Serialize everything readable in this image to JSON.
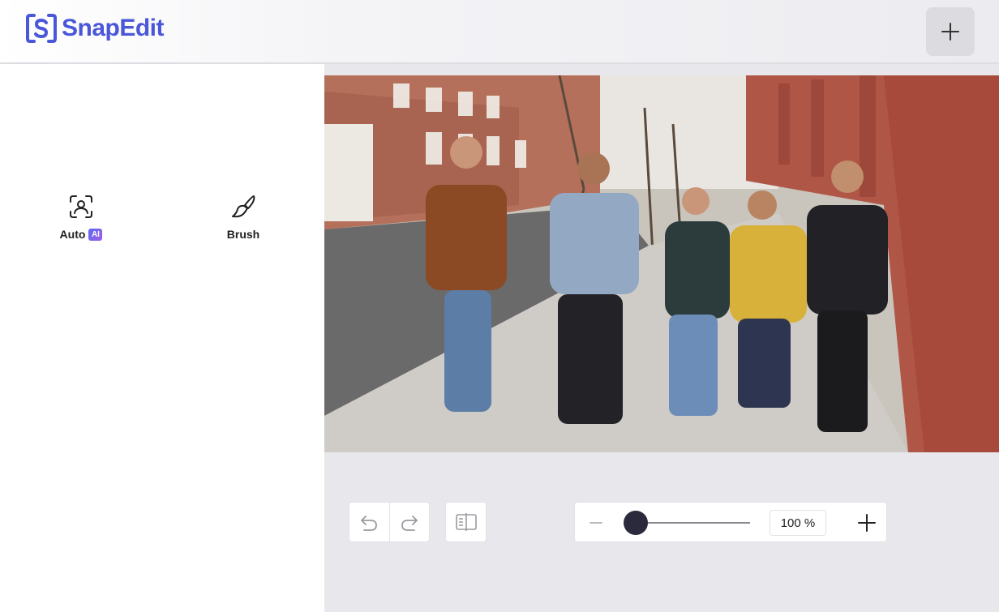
{
  "app": {
    "logo_text": "SnapEdit",
    "logo_icon": "s-bracket-logo"
  },
  "header": {
    "add_button_icon": "plus-icon"
  },
  "sidebar": {
    "tools": [
      {
        "label": "Auto",
        "badge": "AI",
        "icon": "face-scan-icon"
      },
      {
        "label": "Brush",
        "icon": "brush-icon"
      }
    ]
  },
  "toolbar": {
    "undo_icon": "undo-icon",
    "redo_icon": "redo-icon",
    "compare_icon": "compare-icon",
    "zoom": {
      "value": "100 %",
      "minus_icon": "minus-icon",
      "plus_icon": "plus-icon",
      "level": 1.0
    }
  },
  "colors": {
    "brand": "#4a57d8",
    "ai_badge_start": "#5b6cf0",
    "ai_badge_end": "#a05de8",
    "slider_thumb": "#2a2a3c"
  }
}
